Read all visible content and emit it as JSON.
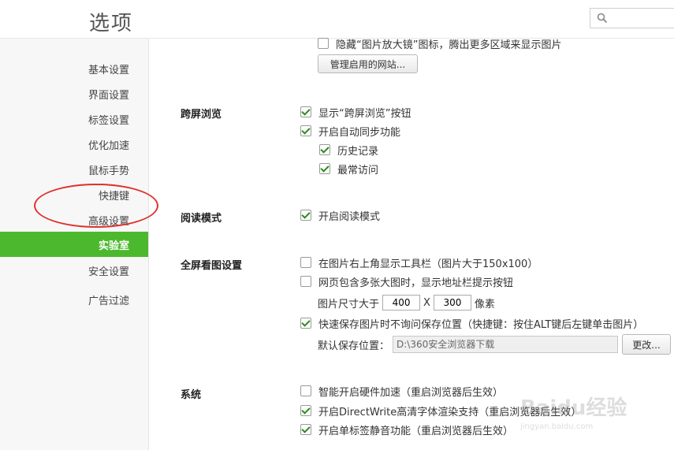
{
  "header": {
    "title": "选项",
    "search_placeholder": ""
  },
  "sidebar": {
    "items": [
      {
        "label": "基本设置"
      },
      {
        "label": "界面设置"
      },
      {
        "label": "标签设置"
      },
      {
        "label": "优化加速"
      },
      {
        "label": "鼠标手势"
      },
      {
        "label": "快捷键"
      },
      {
        "label": "高级设置"
      },
      {
        "label": "实验室",
        "active": true
      },
      {
        "label": "安全设置"
      },
      {
        "label": "广告过滤"
      }
    ]
  },
  "top": {
    "hide_magnifier": {
      "label": "隐藏“图片放大镜”图标，腾出更多区域来显示图片",
      "checked": false
    },
    "manage_sites_label": "管理启用的网站..."
  },
  "cross_screen": {
    "title": "跨屏浏览",
    "options": [
      {
        "label": "显示“跨屏浏览”按钮",
        "checked": true
      },
      {
        "label": "开启自动同步功能",
        "checked": true
      },
      {
        "label": "历史记录",
        "checked": true
      },
      {
        "label": "最常访问",
        "checked": true
      }
    ]
  },
  "reading": {
    "title": "阅读模式",
    "options": [
      {
        "label": "开启阅读模式",
        "checked": true
      }
    ]
  },
  "fullscreen": {
    "title": "全屏看图设置",
    "options": [
      {
        "label": "在图片右上角显示工具栏（图片大于150x100）",
        "checked": false
      },
      {
        "label": "网页包含多张大图时，显示地址栏提示按钮",
        "checked": false
      },
      {
        "label": "快速保存图片时不询问保存位置（快捷键：按住ALT键后左键单击图片）",
        "checked": true
      }
    ],
    "size_prefix": "图片尺寸大于",
    "width": "400",
    "size_x": "X",
    "height": "300",
    "size_unit": "像素",
    "save_location_label": "默认保存位置：",
    "save_path": "D:\\360安全浏览器下载",
    "change_label": "更改..."
  },
  "system": {
    "title": "系统",
    "options": [
      {
        "label": "智能开启硬件加速（重启浏览器后生效）",
        "checked": false
      },
      {
        "label": "开启DirectWrite高清字体渲染支持（重启浏览器后生效）",
        "checked": true
      },
      {
        "label": "开启单标签静音功能（重启浏览器后生效）",
        "checked": true
      }
    ]
  },
  "watermark": {
    "text": "Baidu经验",
    "sub": "jingyan.baidu.com"
  },
  "colors": {
    "accent": "#4cb82e",
    "highlight_circle": "#e0302a"
  }
}
